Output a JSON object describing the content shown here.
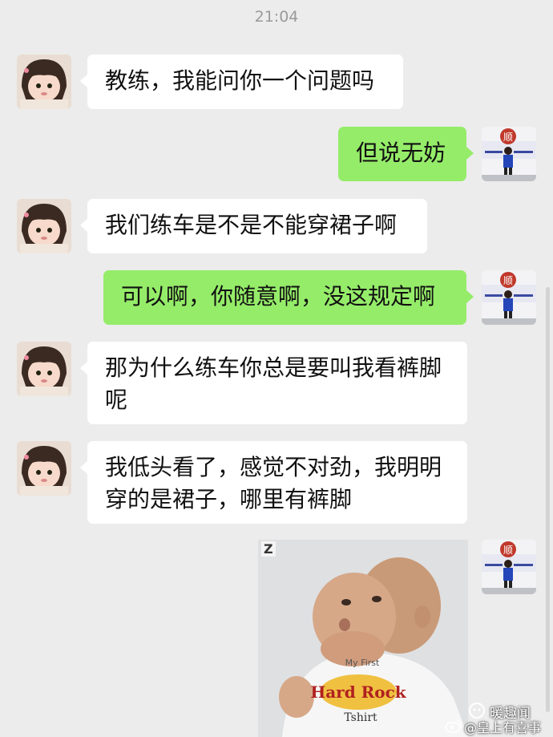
{
  "timestamp": "21:04",
  "messages": [
    {
      "side": "in",
      "text": "教练，我能问你一个问题吗"
    },
    {
      "side": "out",
      "text": "但说无妨"
    },
    {
      "side": "in",
      "text": "我们练车是不是不能穿裙子啊"
    },
    {
      "side": "out",
      "text": "可以啊，你随意啊，没这规定啊"
    },
    {
      "side": "in",
      "line1": "那为什么练车你总是要叫我看裤脚",
      "line2": "呢"
    },
    {
      "side": "in",
      "line1": "我低头看了，感觉不对劲，我明明",
      "line2": "穿的是裙子，哪里有裤脚"
    },
    {
      "side": "out",
      "type": "sticker",
      "badge": "Z",
      "shirt_text": "Hard Rock",
      "shirt_line2": "Tshirt",
      "shirt_top": "My First"
    }
  ],
  "avatars": {
    "incoming": "girl-avatar-icon",
    "outgoing": "coach-avatar-icon",
    "outgoing_sign": "顺"
  },
  "watermark": {
    "name": "暖趣闻",
    "handle": "@皇上有喜事",
    "weibo_icon": "weibo-icon"
  },
  "colors": {
    "background": "#ececec",
    "incoming_bubble": "#ffffff",
    "outgoing_bubble": "#95ec69"
  }
}
